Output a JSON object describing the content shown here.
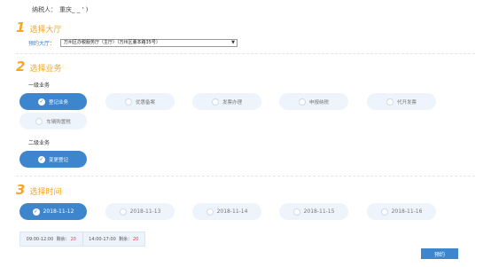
{
  "taxpayer": {
    "label": "纳税人：",
    "value": "重庆_ _             ' )"
  },
  "step1": {
    "num": "1",
    "title": "选择大厅"
  },
  "hall": {
    "label": "预约大厅：",
    "selected": "万州区办税服务厅（主厅）（万州区董本路35号）"
  },
  "step2": {
    "num": "2",
    "title": "选择业务"
  },
  "level1": {
    "label": "一级业务",
    "items": [
      {
        "label": "登记业务",
        "checked": true
      },
      {
        "label": "优惠备案",
        "checked": false
      },
      {
        "label": "发票办理",
        "checked": false
      },
      {
        "label": "申报纳税",
        "checked": false
      },
      {
        "label": "代开发票",
        "checked": false
      },
      {
        "label": "车辆购置税",
        "checked": false
      }
    ]
  },
  "level2": {
    "label": "二级业务",
    "items": [
      {
        "label": "变更登记",
        "checked": true
      }
    ]
  },
  "step3": {
    "num": "3",
    "title": "选择时间"
  },
  "dates": [
    {
      "label": "2018-11-12",
      "checked": true
    },
    {
      "label": "2018-11-13",
      "checked": false
    },
    {
      "label": "2018-11-14",
      "checked": false
    },
    {
      "label": "2018-11-15",
      "checked": false
    },
    {
      "label": "2018-11-16",
      "checked": false
    }
  ],
  "slots": [
    {
      "time": "09:00-12:00",
      "remain_label": "剩余：",
      "remain": "20"
    },
    {
      "time": "14:00-17:00",
      "remain_label": "剩余：",
      "remain": "20"
    }
  ],
  "reserve_label": "预约",
  "colors": {
    "accent": "#3d86cd",
    "heading": "#f5a623",
    "remain": "#e03b3b"
  }
}
